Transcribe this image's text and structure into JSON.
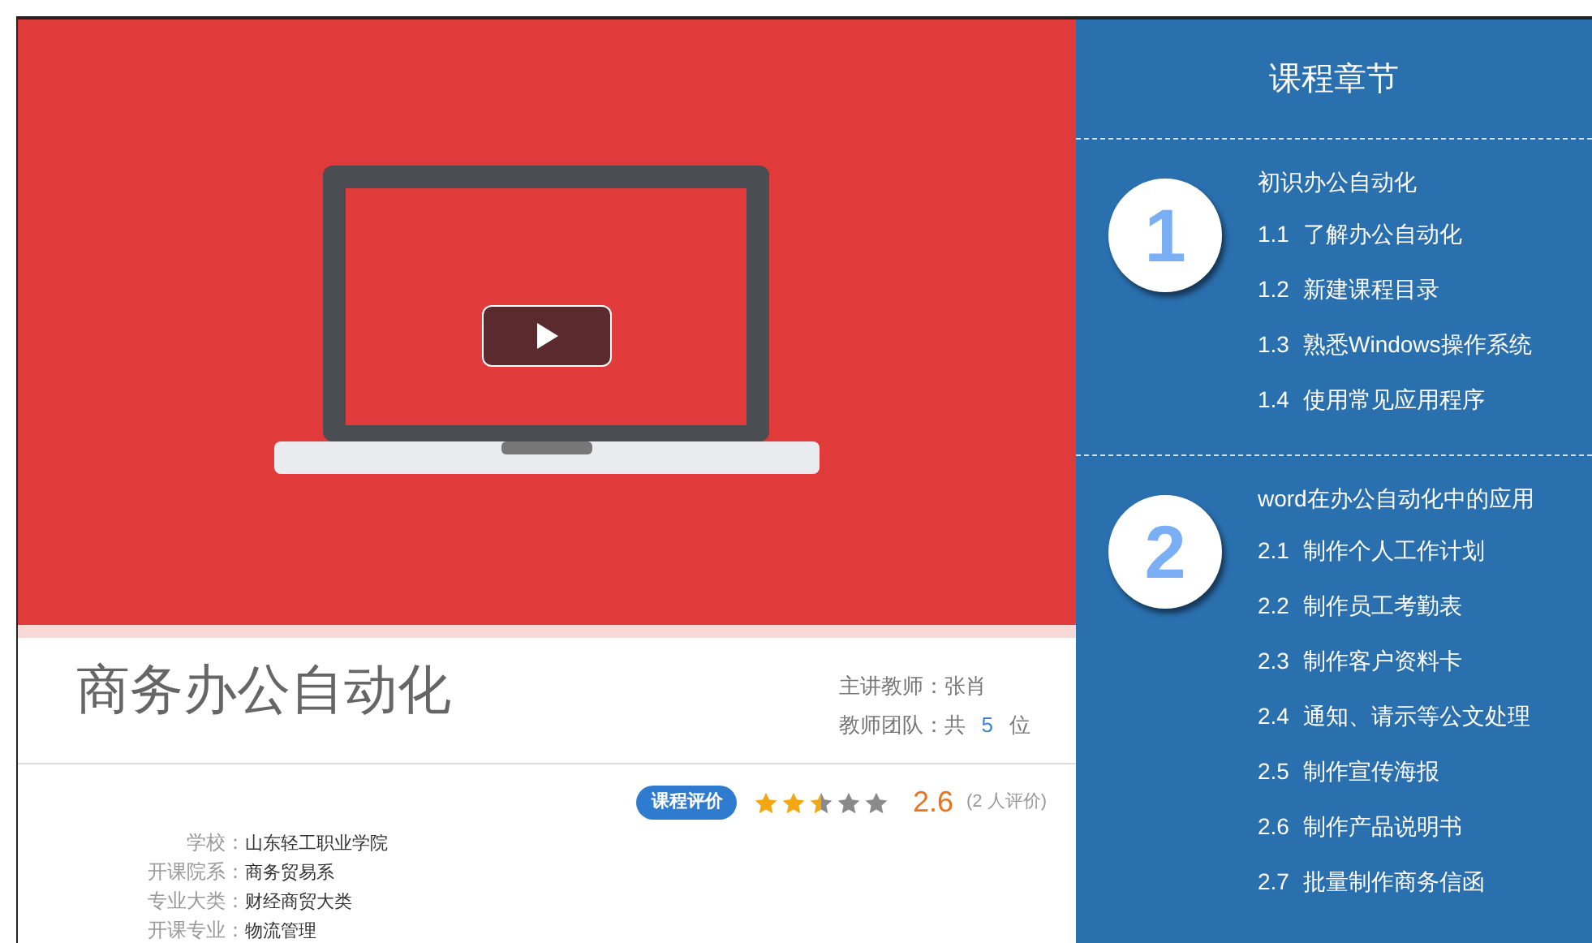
{
  "course": {
    "title": "商务办公自动化",
    "lead_teacher_label": "主讲教师：",
    "lead_teacher": "张肖",
    "team_label": "教师团队：",
    "team_prefix": "共",
    "team_count": "5",
    "team_suffix": "位"
  },
  "rating": {
    "badge": "课程评价",
    "stars": 2.5,
    "score": "2.6",
    "count": "(2 人评价)"
  },
  "details": [
    {
      "label": "学校：",
      "value": "山东轻工职业学院"
    },
    {
      "label": "开课院系：",
      "value": "商务贸易系"
    },
    {
      "label": "专业大类：",
      "value": "财经商贸大类"
    },
    {
      "label": "开课专业：",
      "value": "物流管理"
    }
  ],
  "chapters_panel": {
    "title": "课程章节",
    "chapters": [
      {
        "number": "1",
        "title": "初识办公自动化",
        "sections": [
          {
            "number": "1.1",
            "title": "了解办公自动化"
          },
          {
            "number": "1.2",
            "title": "新建课程目录"
          },
          {
            "number": "1.3",
            "title": "熟悉Windows操作系统"
          },
          {
            "number": "1.4",
            "title": "使用常见应用程序"
          }
        ]
      },
      {
        "number": "2",
        "title": "word在办公自动化中的应用",
        "sections": [
          {
            "number": "2.1",
            "title": "制作个人工作计划"
          },
          {
            "number": "2.2",
            "title": "制作员工考勤表"
          },
          {
            "number": "2.3",
            "title": "制作客户资料卡"
          },
          {
            "number": "2.4",
            "title": "通知、请示等公文处理"
          },
          {
            "number": "2.5",
            "title": "制作宣传海报"
          },
          {
            "number": "2.6",
            "title": "制作产品说明书"
          },
          {
            "number": "2.7",
            "title": "批量制作商务信函"
          }
        ]
      }
    ]
  }
}
